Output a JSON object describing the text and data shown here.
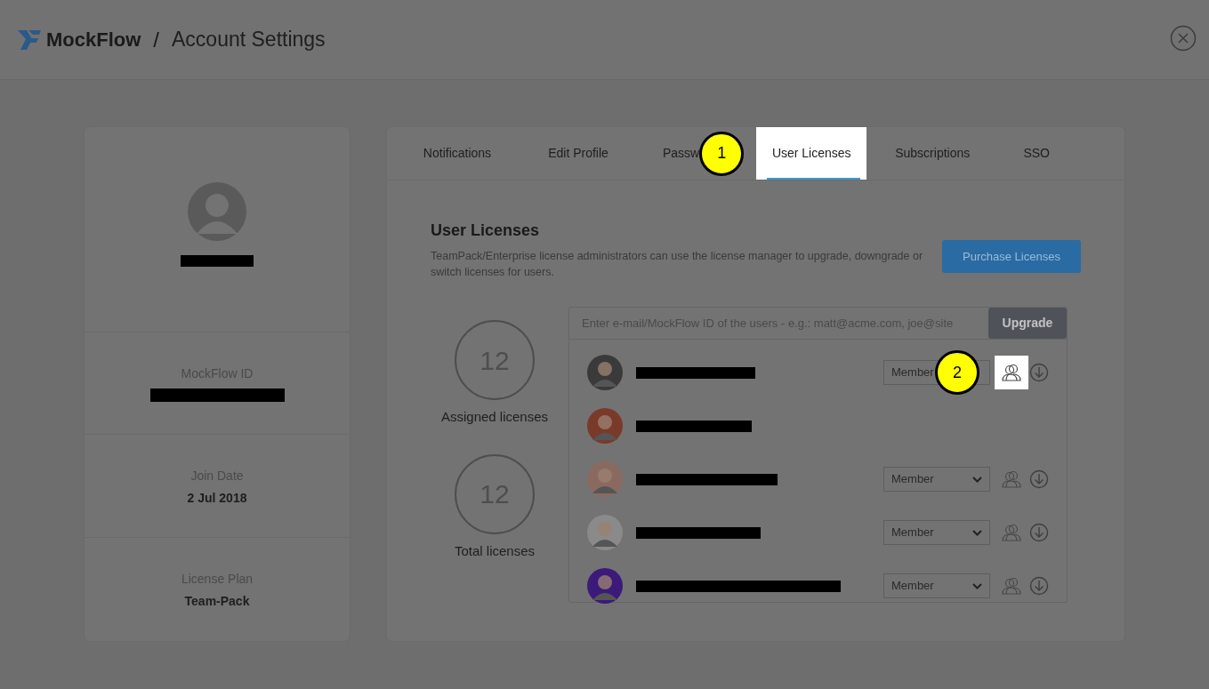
{
  "header": {
    "brand": "MockFlow",
    "separator": "/",
    "title": "Account Settings"
  },
  "profile": {
    "fields": [
      {
        "label": "MockFlow ID",
        "redacted": true
      },
      {
        "label": "Join Date",
        "value": "2 Jul 2018"
      },
      {
        "label": "License Plan",
        "value": "Team-Pack"
      }
    ]
  },
  "tabs": [
    {
      "label": "Notifications",
      "selected": false
    },
    {
      "label": "Edit Profile",
      "selected": false
    },
    {
      "label": "Passw",
      "selected": false,
      "callout": "1"
    },
    {
      "label": "User Licenses",
      "selected": true
    },
    {
      "label": "Subscriptions",
      "selected": false
    },
    {
      "label": "SSO",
      "selected": false
    }
  ],
  "section": {
    "title": "User Licenses",
    "description": "TeamPack/Enterprise license administrators can use the license manager to upgrade, downgrade or switch licenses for users.",
    "button": "Purchase Licenses"
  },
  "stats": [
    {
      "value": "12",
      "label": "Assigned licenses"
    },
    {
      "value": "12",
      "label": "Total licenses"
    }
  ],
  "users": {
    "placeholder": "Enter e-mail/MockFlow ID of the users - e.g.: matt@acme.com, joe@site",
    "button": "Upgrade",
    "rows": [
      {
        "role": "Member",
        "icon_highlighted": true,
        "callout": "2"
      },
      {},
      {
        "role": "Member",
        "icon_highlighted": false
      },
      {
        "role": "Member",
        "icon_highlighted": false
      },
      {
        "role": "Member",
        "icon_highlighted": false
      }
    ]
  }
}
